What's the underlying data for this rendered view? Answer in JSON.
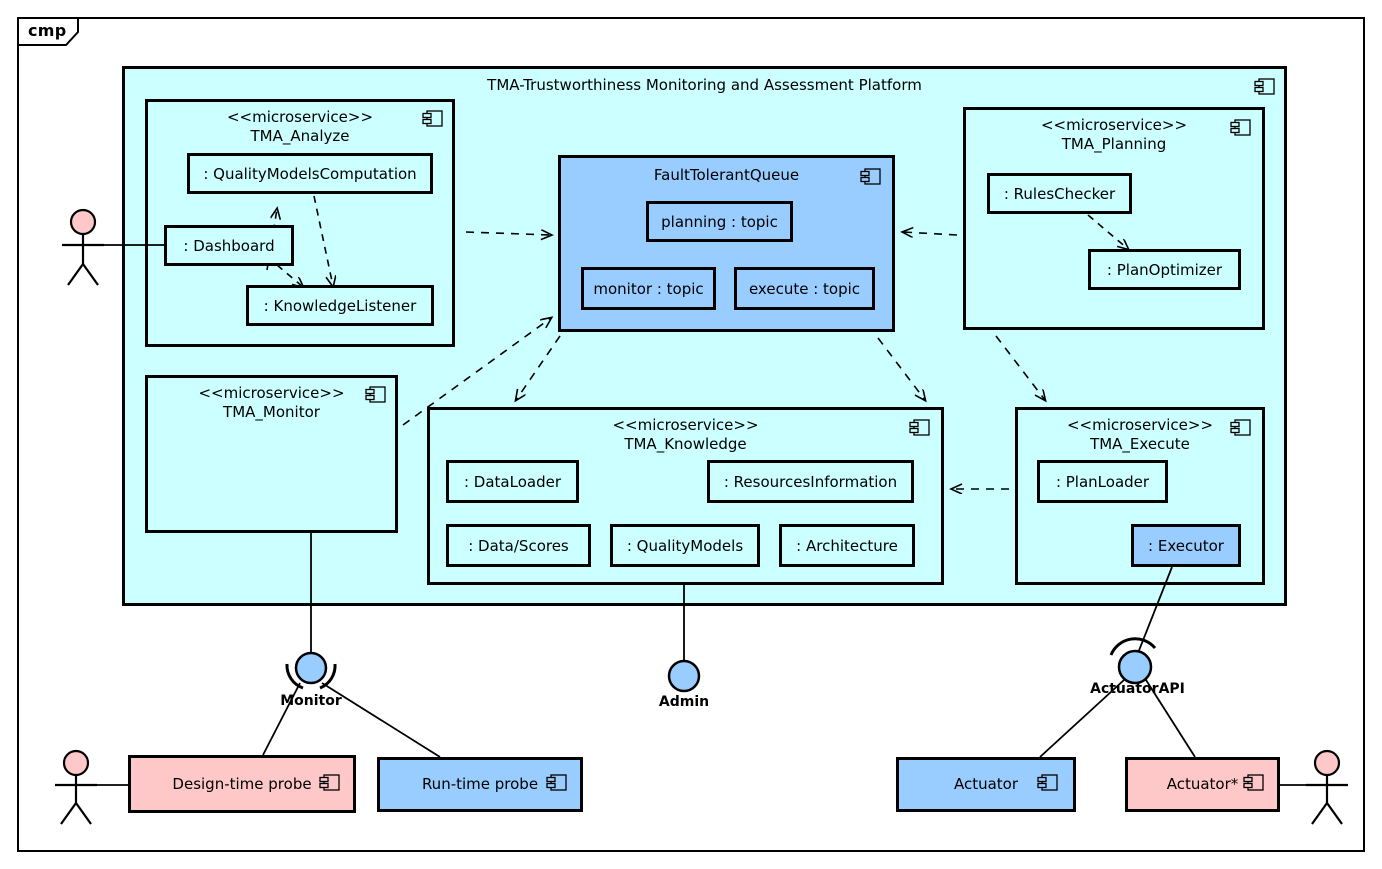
{
  "diagram": {
    "frame_label": "cmp",
    "platform_title": "TMA-Trustworthiness Monitoring and Assessment Platform",
    "stereotype": "<<microservice>>",
    "colors": {
      "cyan_fill": "#ccffff",
      "blue_fill": "#99ccff",
      "pink_fill": "#ffc8c8",
      "border": "#000000",
      "actor_head": "#ffc8c8",
      "port_ball": "#99ccff"
    }
  },
  "components": {
    "analyze": {
      "stereotype": "<<microservice>>",
      "name": "TMA_Analyze",
      "parts": [
        {
          "label": ": QualityModelsComputation"
        },
        {
          "label": ": Dashboard"
        },
        {
          "label": ": KnowledgeListener"
        }
      ]
    },
    "monitor": {
      "stereotype": "<<microservice>>",
      "name": "TMA_Monitor",
      "parts": []
    },
    "queue": {
      "name": "FaultTolerantQueue",
      "parts": [
        {
          "label": "planning : topic"
        },
        {
          "label": "monitor : topic"
        },
        {
          "label": "execute : topic"
        }
      ]
    },
    "planning": {
      "stereotype": "<<microservice>>",
      "name": "TMA_Planning",
      "parts": [
        {
          "label": ": RulesChecker"
        },
        {
          "label": ": PlanOptimizer"
        }
      ]
    },
    "knowledge": {
      "stereotype": "<<microservice>>",
      "name": "TMA_Knowledge",
      "parts": [
        {
          "label": ": DataLoader"
        },
        {
          "label": ": ResourcesInformation"
        },
        {
          "label": ": Data/Scores"
        },
        {
          "label": ": QualityModels"
        },
        {
          "label": ": Architecture"
        }
      ]
    },
    "execute": {
      "stereotype": "<<microservice>>",
      "name": "TMA_Execute",
      "parts": [
        {
          "label": ": PlanLoader"
        },
        {
          "label": ": Executor"
        }
      ]
    }
  },
  "ports": [
    {
      "id": "monitor-port",
      "label": "Monitor"
    },
    {
      "id": "admin-port",
      "label": "Admin"
    },
    {
      "id": "actuatorapi-port",
      "label": "ActuatorAPI"
    }
  ],
  "external": [
    {
      "id": "design-time-probe",
      "label": "Design-time probe",
      "fill": "pink"
    },
    {
      "id": "run-time-probe",
      "label": "Run-time probe",
      "fill": "blue"
    },
    {
      "id": "actuator",
      "label": "Actuator",
      "fill": "blue"
    },
    {
      "id": "actuator-star",
      "label": "Actuator*",
      "fill": "pink"
    }
  ],
  "actors": [
    {
      "id": "actor-dashboard-user"
    },
    {
      "id": "actor-probe-user"
    },
    {
      "id": "actor-actuator-user"
    }
  ]
}
